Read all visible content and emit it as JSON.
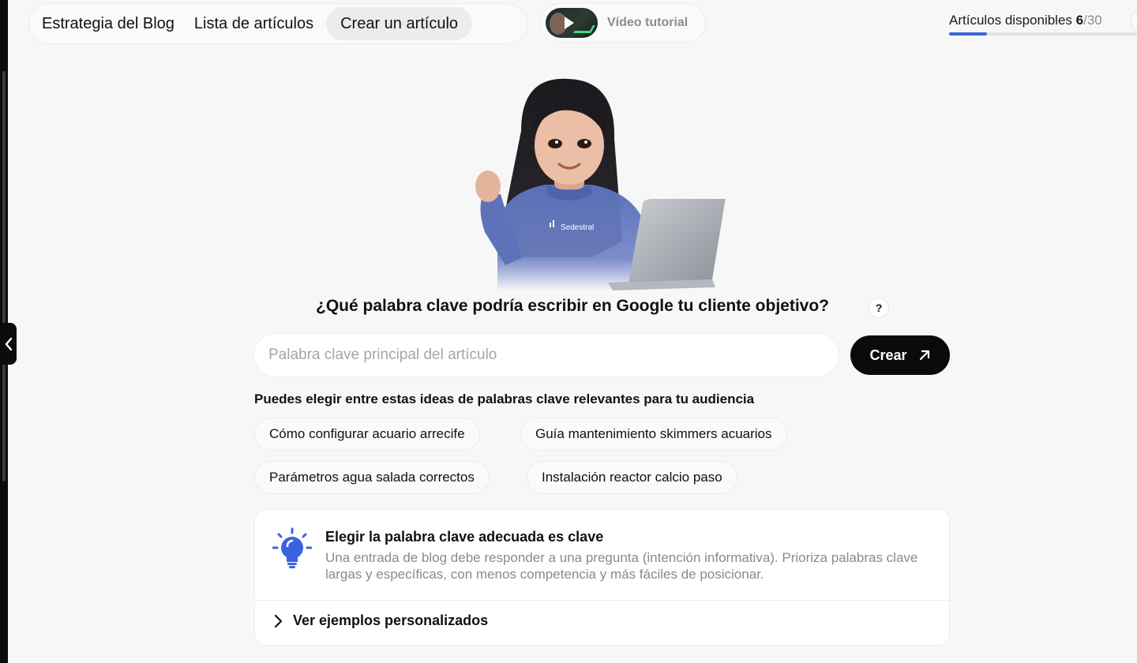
{
  "nav": {
    "tabs": [
      {
        "label": "Estrategia del Blog"
      },
      {
        "label": "Lista de artículos"
      },
      {
        "label": "Crear un artículo",
        "active": true
      }
    ],
    "tutorial_label": "Vídeo tutorial"
  },
  "availability": {
    "label": "Artículos disponibles",
    "used": "6",
    "total": "/30",
    "progress_fraction": 0.2
  },
  "hero": {
    "shirt_brand": "Sedestral"
  },
  "form": {
    "question": "¿Qué palabra clave podría escribir en Google tu cliente objetivo?",
    "help_icon": "?",
    "input_placeholder": "Palabra clave principal del artículo",
    "input_value": "",
    "create_label": "Crear"
  },
  "ideas": {
    "title": "Puedes elegir entre estas ideas de palabras clave relevantes para tu audiencia",
    "chips": [
      "Cómo configurar acuario arrecife",
      "Guía mantenimiento skimmers acuarios",
      "Parámetros agua salada correctos",
      "Instalación reactor calcio paso"
    ]
  },
  "tip": {
    "title": "Elegir la palabra clave adecuada es clave",
    "body": "Una entrada de blog debe responder a una pregunta (intención informativa). Prioriza palabras clave largas y específicas, con menos competencia y más fáciles de posicionar.",
    "examples_label": "Ver ejemplos personalizados"
  },
  "colors": {
    "accent": "#3b63e0",
    "button_bg": "#0b0b0b",
    "background": "#f7f7f8"
  },
  "icons": {
    "collapse": "chevron-left-icon",
    "create": "arrow-up-right-icon",
    "tip": "lightbulb-icon",
    "examples": "chevron-right-icon"
  }
}
